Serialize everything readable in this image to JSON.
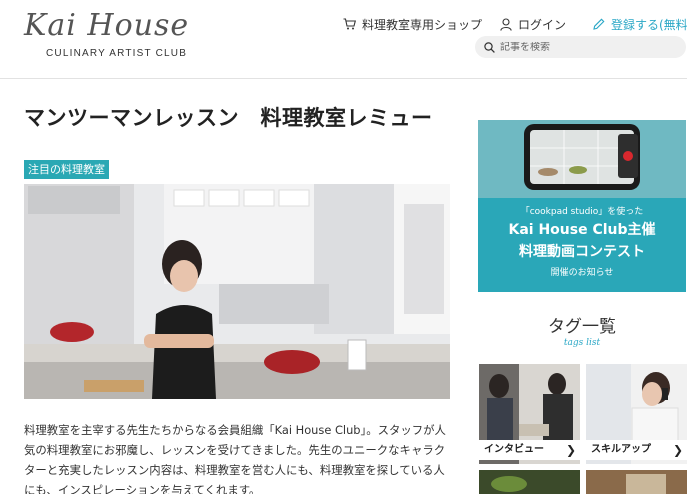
{
  "header": {
    "logo_script": "Kai House",
    "logo_sub": "CULINARY ARTIST CLUB",
    "nav": {
      "shop": "料理教室専用ショップ",
      "login": "ログイン",
      "register": "登録する(無料)"
    },
    "search_placeholder": "記事を検索"
  },
  "article": {
    "title": "マンツーマンレッスン　料理教室レミュー",
    "category": "注目の料理教室",
    "intro": "料理教室を主宰する先生たちからなる会員組織「Kai House Club」。スタッフが人気の料理教室にお邪魔し、レッスンを受けてきました。先生のユニークなキャラクターと充実したレッスン内容は、料理教室を営む人にも、料理教室を探している人にも、インスピレーションを与えてくれます。"
  },
  "sidebar": {
    "banner": {
      "small": "「cookpad studio」を使った",
      "line1": "Kai House Club主催",
      "line2": "料理動画コンテスト",
      "notice": "開催のお知らせ"
    },
    "tags_heading": "タグ一覧",
    "tags_sub": "tags list",
    "tags": [
      {
        "label": "インタビュー"
      },
      {
        "label": "スキルアップ"
      }
    ]
  },
  "colors": {
    "accent": "#2aa7c6",
    "badge": "#2aa8b4"
  }
}
